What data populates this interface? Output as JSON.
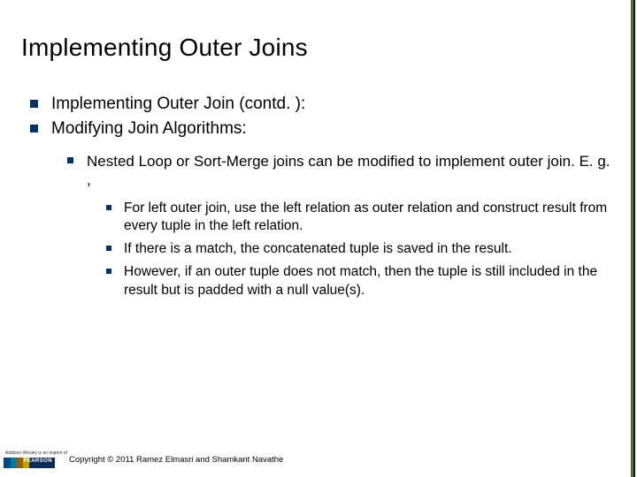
{
  "title": "Implementing Outer Joins",
  "lvl1": [
    "Implementing Outer Join (contd. ):",
    "Modifying Join Algorithms:"
  ],
  "lvl2": "Nested Loop or Sort-Merge joins can be modified to implement outer join. E. g. ,",
  "lvl3": [
    "For left outer join, use the left relation as outer relation and construct result from every tuple in the left relation.",
    "If there is a match, the concatenated tuple is saved in the result.",
    "However, if an outer tuple does not match, then the tuple is still included in the result but is padded with a null value(s)."
  ],
  "footer": "Copyright © 2011 Ramez Elmasri and Shamkant Navathe",
  "logo_top": "Addison-Wesley is an imprint of"
}
